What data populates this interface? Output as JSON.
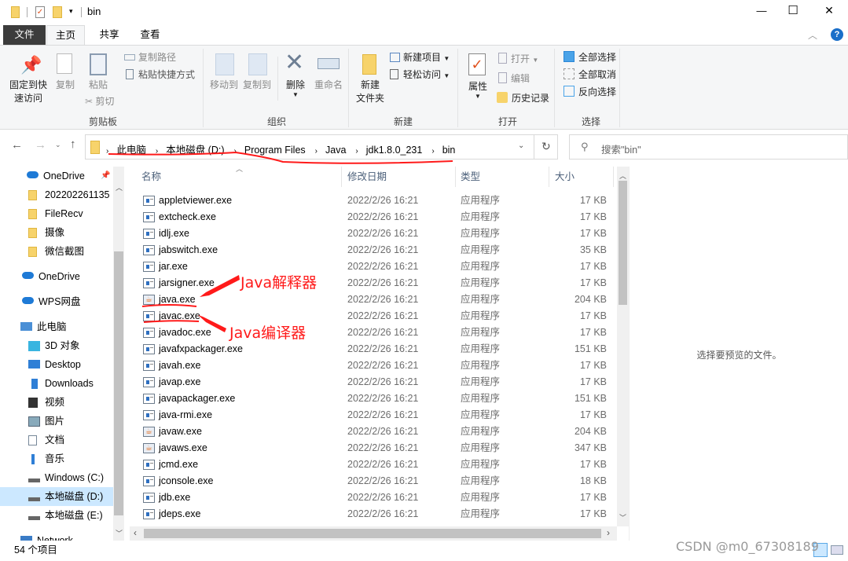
{
  "window": {
    "title": "bin",
    "minimize": "—",
    "maximize": "☐",
    "close": "✕"
  },
  "tabs": [
    {
      "label": "文件"
    },
    {
      "label": "主页"
    },
    {
      "label": "共享"
    },
    {
      "label": "查看"
    }
  ],
  "ribbon": {
    "clipboard": {
      "pin": "固定到快",
      "pin2": "速访问",
      "copy": "复制",
      "paste": "粘贴",
      "copy_path": "复制路径",
      "paste_shortcut": "粘贴快捷方式",
      "cut": "剪切",
      "label": "剪贴板"
    },
    "organize": {
      "move_to": "移动到",
      "copy_to": "复制到",
      "delete": "删除",
      "rename": "重命名",
      "label": "组织"
    },
    "new": {
      "new_folder": "新建",
      "new_folder2": "文件夹",
      "new_item": "新建项目",
      "easy_access": "轻松访问",
      "label": "新建"
    },
    "open": {
      "properties": "属性",
      "open": "打开",
      "edit": "编辑",
      "history": "历史记录",
      "label": "打开"
    },
    "select": {
      "select_all": "全部选择",
      "select_none": "全部取消",
      "invert": "反向选择",
      "label": "选择"
    }
  },
  "address": {
    "crumbs": [
      "此电脑",
      "本地磁盘 (D:)",
      "Program Files",
      "Java",
      "jdk1.8.0_231",
      "bin"
    ],
    "search_placeholder": "搜索\"bin\""
  },
  "nav": [
    {
      "label": "OneDrive",
      "icon": "cloud-icon",
      "pinned": true
    },
    {
      "label": "202202261135",
      "icon": "folder-icon"
    },
    {
      "label": "FileRecv",
      "icon": "folder-icon"
    },
    {
      "label": "摄像",
      "icon": "folder-icon"
    },
    {
      "label": "微信截图",
      "icon": "folder-icon"
    },
    {
      "label": "OneDrive",
      "icon": "cloud-icon"
    },
    {
      "label": "WPS网盘",
      "icon": "cloud-icon"
    },
    {
      "label": "此电脑",
      "icon": "computer-icon"
    },
    {
      "label": "3D 对象",
      "icon": "cube-icon"
    },
    {
      "label": "Desktop",
      "icon": "desktop-icon"
    },
    {
      "label": "Downloads",
      "icon": "download-icon"
    },
    {
      "label": "视频",
      "icon": "video-icon"
    },
    {
      "label": "图片",
      "icon": "picture-icon"
    },
    {
      "label": "文档",
      "icon": "document-icon"
    },
    {
      "label": "音乐",
      "icon": "music-icon"
    },
    {
      "label": "Windows (C:)",
      "icon": "drive-icon"
    },
    {
      "label": "本地磁盘 (D:)",
      "icon": "drive-icon",
      "selected": true
    },
    {
      "label": "本地磁盘 (E:)",
      "icon": "drive-icon"
    },
    {
      "label": "Network",
      "icon": "network-icon"
    }
  ],
  "columns": {
    "name": "名称",
    "date": "修改日期",
    "type": "类型",
    "size": "大小"
  },
  "files": [
    {
      "name": "appletviewer.exe",
      "date": "2022/2/26 16:21",
      "type": "应用程序",
      "size": "17 KB"
    },
    {
      "name": "extcheck.exe",
      "date": "2022/2/26 16:21",
      "type": "应用程序",
      "size": "17 KB"
    },
    {
      "name": "idlj.exe",
      "date": "2022/2/26 16:21",
      "type": "应用程序",
      "size": "17 KB"
    },
    {
      "name": "jabswitch.exe",
      "date": "2022/2/26 16:21",
      "type": "应用程序",
      "size": "35 KB"
    },
    {
      "name": "jar.exe",
      "date": "2022/2/26 16:21",
      "type": "应用程序",
      "size": "17 KB"
    },
    {
      "name": "jarsigner.exe",
      "date": "2022/2/26 16:21",
      "type": "应用程序",
      "size": "17 KB"
    },
    {
      "name": "java.exe",
      "date": "2022/2/26 16:21",
      "type": "应用程序",
      "size": "204 KB",
      "java": true
    },
    {
      "name": "javac.exe",
      "date": "2022/2/26 16:21",
      "type": "应用程序",
      "size": "17 KB"
    },
    {
      "name": "javadoc.exe",
      "date": "2022/2/26 16:21",
      "type": "应用程序",
      "size": "17 KB"
    },
    {
      "name": "javafxpackager.exe",
      "date": "2022/2/26 16:21",
      "type": "应用程序",
      "size": "151 KB"
    },
    {
      "name": "javah.exe",
      "date": "2022/2/26 16:21",
      "type": "应用程序",
      "size": "17 KB"
    },
    {
      "name": "javap.exe",
      "date": "2022/2/26 16:21",
      "type": "应用程序",
      "size": "17 KB"
    },
    {
      "name": "javapackager.exe",
      "date": "2022/2/26 16:21",
      "type": "应用程序",
      "size": "151 KB"
    },
    {
      "name": "java-rmi.exe",
      "date": "2022/2/26 16:21",
      "type": "应用程序",
      "size": "17 KB"
    },
    {
      "name": "javaw.exe",
      "date": "2022/2/26 16:21",
      "type": "应用程序",
      "size": "204 KB",
      "java": true
    },
    {
      "name": "javaws.exe",
      "date": "2022/2/26 16:21",
      "type": "应用程序",
      "size": "347 KB",
      "java": true
    },
    {
      "name": "jcmd.exe",
      "date": "2022/2/26 16:21",
      "type": "应用程序",
      "size": "17 KB"
    },
    {
      "name": "jconsole.exe",
      "date": "2022/2/26 16:21",
      "type": "应用程序",
      "size": "18 KB"
    },
    {
      "name": "jdb.exe",
      "date": "2022/2/26 16:21",
      "type": "应用程序",
      "size": "17 KB"
    },
    {
      "name": "jdeps.exe",
      "date": "2022/2/26 16:21",
      "type": "应用程序",
      "size": "17 KB"
    }
  ],
  "preview": {
    "message": "选择要预览的文件。"
  },
  "status": {
    "count": "54 个项目"
  },
  "annotations": {
    "interpreter": "Java解释器",
    "compiler": "Java编译器",
    "color": "#ff1a1a"
  },
  "watermark": "CSDN @m0_67308189",
  "colors": {
    "file_tab": "#3c3c3c",
    "selection": "#cce8ff",
    "header_text": "#4c607a"
  }
}
